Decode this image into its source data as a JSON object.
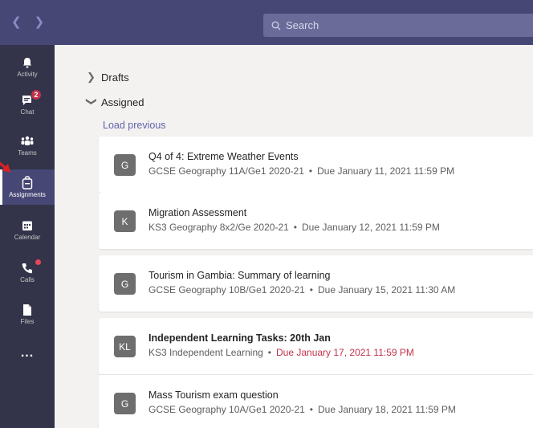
{
  "topbar": {
    "back_icon": "chevron-left-icon",
    "forward_icon": "chevron-right-icon",
    "search_placeholder": "Search"
  },
  "rail": {
    "items": [
      {
        "label": "Activity",
        "icon": "bell-icon"
      },
      {
        "label": "Chat",
        "icon": "chat-icon",
        "badge": "2"
      },
      {
        "label": "Teams",
        "icon": "teams-icon"
      },
      {
        "label": "Assignments",
        "icon": "assignments-icon",
        "active": true
      },
      {
        "label": "Calendar",
        "icon": "calendar-icon"
      },
      {
        "label": "Calls",
        "icon": "phone-icon"
      },
      {
        "label": "Files",
        "icon": "file-icon"
      },
      {
        "label": "...",
        "icon": "more-icon"
      }
    ]
  },
  "main": {
    "drafts_label": "Drafts",
    "assigned_label": "Assigned",
    "load_previous": "Load previous",
    "assignments": [
      {
        "initials": "G",
        "title": "Q4 of 4: Extreme Weather Events",
        "class": "GCSE Geography 11A/Ge1 2020-21",
        "due": "Due January 11, 2021 11:59 PM",
        "late": false,
        "bold": false
      },
      {
        "initials": "K",
        "title": "Migration Assessment",
        "class": "KS3 Geography 8x2/Ge 2020-21",
        "due": "Due January 12, 2021 11:59 PM",
        "late": false,
        "bold": false
      },
      {
        "initials": "G",
        "title": "Tourism in Gambia: Summary of learning",
        "class": "GCSE Geography 10B/Ge1 2020-21",
        "due": "Due January 15, 2021 11:30 AM",
        "late": false,
        "bold": false
      },
      {
        "initials": "KL",
        "title": "Independent Learning Tasks: 20th Jan",
        "class": "KS3 Independent Learning",
        "due": "Due January 17, 2021 11:59 PM",
        "late": true,
        "bold": true
      },
      {
        "initials": "G",
        "title": "Mass Tourism exam question",
        "class": "GCSE Geography 10A/Ge1 2020-21",
        "due": "Due January 18, 2021 11:59 PM",
        "late": false,
        "bold": false
      }
    ],
    "separator": "•"
  },
  "colors": {
    "topbar": "#464775",
    "rail": "#33344a",
    "accent": "#6264a7",
    "late": "#c4314b",
    "badge": "#c4314b"
  }
}
